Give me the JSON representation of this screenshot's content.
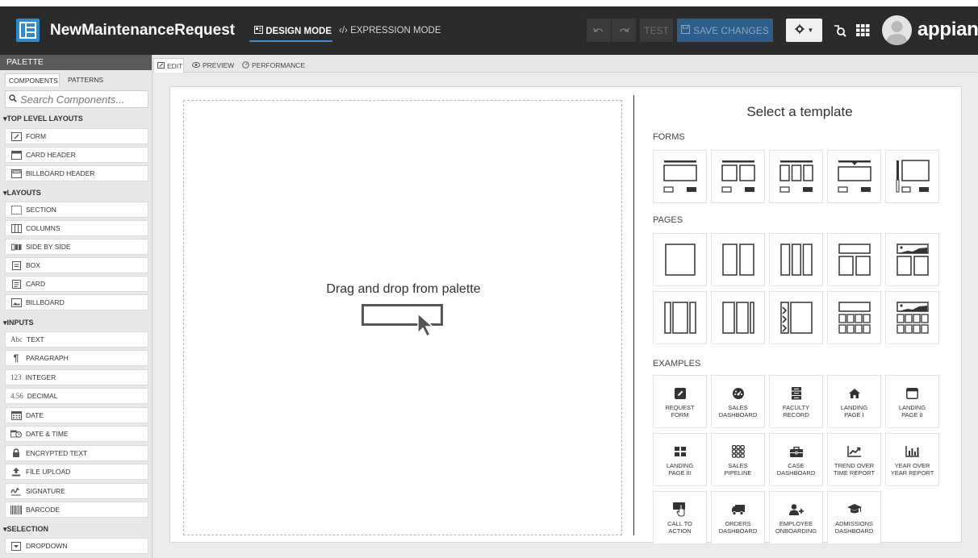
{
  "header": {
    "app_title": "NewMaintenanceRequest",
    "design_mode": "DESIGN MODE",
    "expression_mode": "EXPRESSION MODE",
    "test_label": "TEST",
    "save_label": "SAVE CHANGES",
    "brand": "appian"
  },
  "palette": {
    "title": "PALETTE",
    "tabs": [
      "COMPONENTS",
      "PATTERNS"
    ],
    "search_placeholder": "Search Components...",
    "categories": {
      "top_level": "TOP LEVEL LAYOUTS",
      "layouts": "LAYOUTS",
      "inputs": "INPUTS",
      "selection": "SELECTION"
    },
    "items": {
      "form": "FORM",
      "card_header": "CARD HEADER",
      "billboard_header": "BILLBOARD HEADER",
      "section": "SECTION",
      "columns": "COLUMNS",
      "side_by_side": "SIDE BY SIDE",
      "box": "BOX",
      "card": "CARD",
      "billboard": "BILLBOARD",
      "text": "TEXT",
      "paragraph": "PARAGRAPH",
      "integer": "INTEGER",
      "decimal": "DECIMAL",
      "date": "DATE",
      "date_time": "DATE & TIME",
      "encrypted_text": "ENCRYPTED TEXT",
      "file_upload": "FILE UPLOAD",
      "signature": "SIGNATURE",
      "barcode": "BARCODE",
      "dropdown": "DROPDOWN"
    },
    "icon_text": {
      "text": "Abc",
      "integer": "123",
      "decimal": "4.56"
    }
  },
  "editor_tabs": {
    "edit": "EDIT",
    "preview": "PREVIEW",
    "performance": "PERFORMANCE"
  },
  "canvas": {
    "drop_text": "Drag and drop from palette"
  },
  "templates": {
    "title": "Select a template",
    "forms_label": "FORMS",
    "pages_label": "PAGES",
    "examples_label": "EXAMPLES",
    "examples": {
      "e1": "REQUEST\nFORM",
      "e2": "SALES\nDASHBOARD",
      "e3": "FACULTY\nRECORD",
      "e4": "LANDING\nPAGE I",
      "e5": "LANDING\nPAGE II",
      "e6": "LANDING\nPAGE III",
      "e7": "SALES\nPIPELINE",
      "e8": "CASE\nDASHBOARD",
      "e9": "TREND OVER\nTIME REPORT",
      "e10": "YEAR OVER\nYEAR REPORT",
      "e11": "CALL TO\nACTION",
      "e12": "ORDERS\nDASHBOARD",
      "e13": "EMPLOYEE\nONBOARDING",
      "e14": "ADMISSIONS\nDASHBOARD"
    }
  },
  "colors": {
    "header_bg": "#2b2b2b",
    "accent": "#3b8fd6",
    "save_button": "#2d5d8a"
  }
}
